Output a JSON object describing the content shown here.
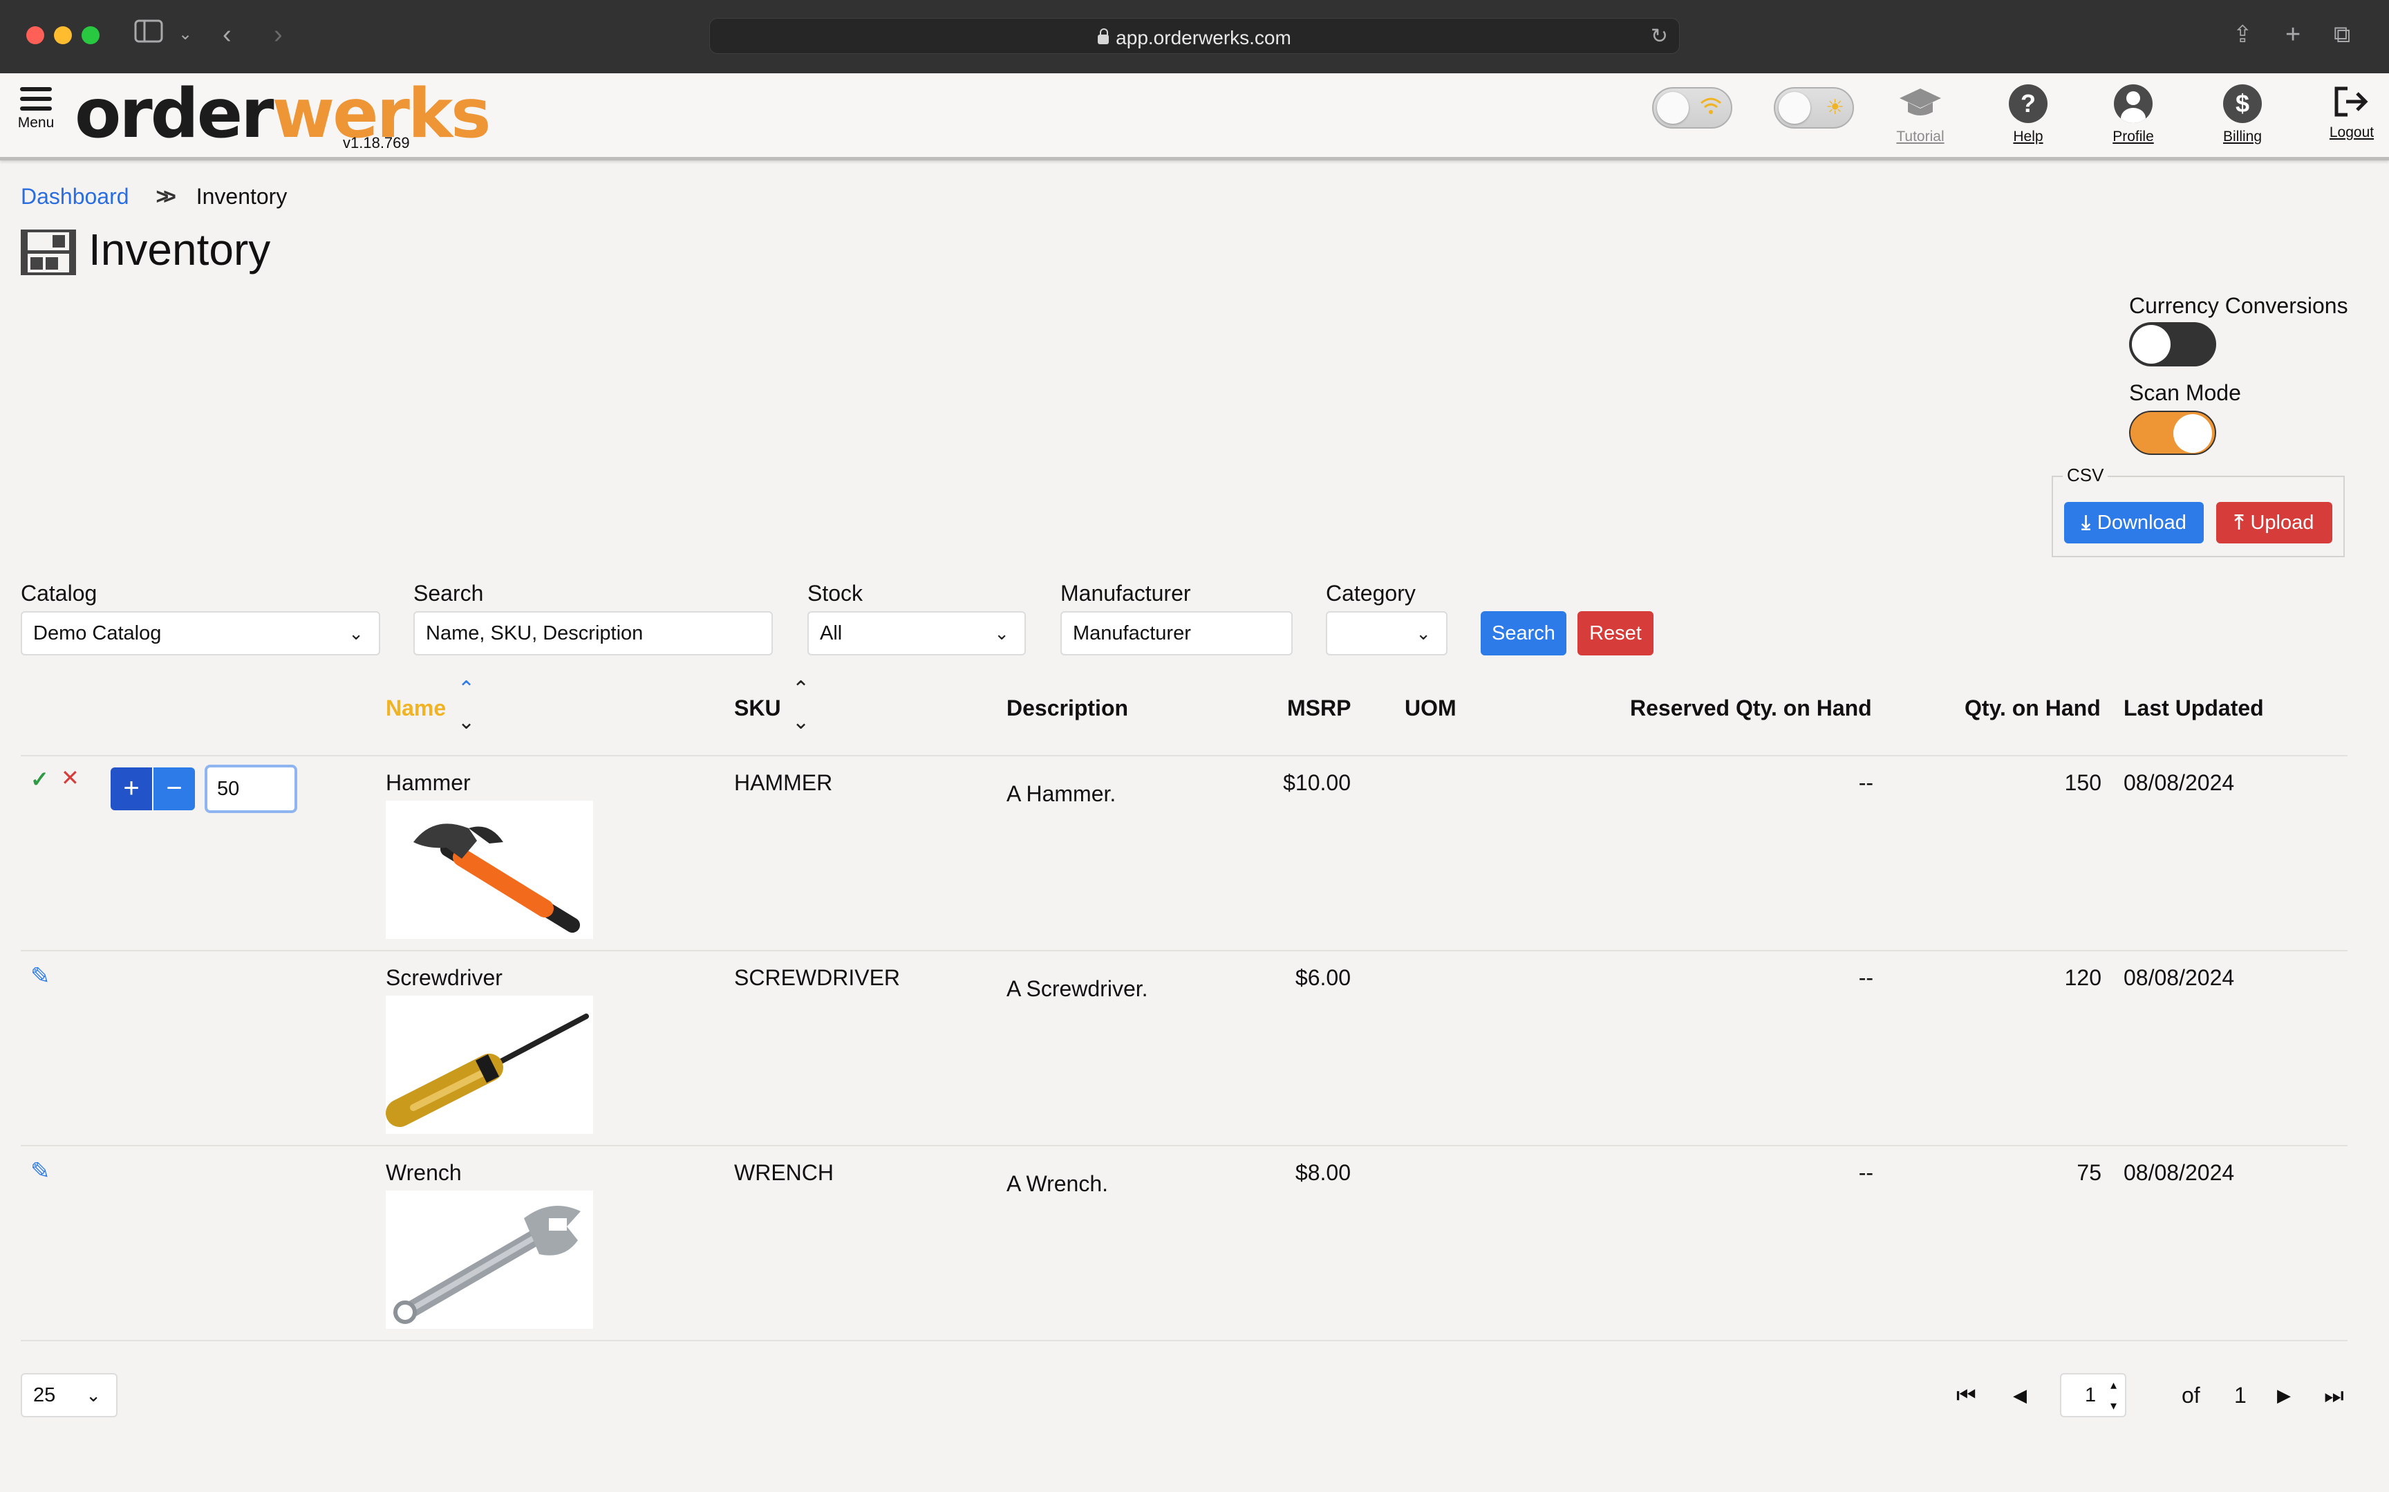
{
  "browser": {
    "url": "app.orderwerks.com"
  },
  "header": {
    "menu_label": "Menu",
    "logo_part1": "order",
    "logo_part2": "werks",
    "version": "v1.18.769",
    "nav": [
      {
        "label": "Tutorial",
        "icon": "graduation-cap-icon"
      },
      {
        "label": "Help",
        "icon": "question-icon"
      },
      {
        "label": "Profile",
        "icon": "user-icon"
      },
      {
        "label": "Billing",
        "icon": "dollar-icon"
      },
      {
        "label": "Logout",
        "icon": "logout-icon"
      }
    ],
    "toggles": [
      {
        "icon": "wifi-icon"
      },
      {
        "icon": "sun-icon"
      }
    ]
  },
  "breadcrumb": {
    "dashboard": "Dashboard",
    "current": "Inventory"
  },
  "page_title": "Inventory",
  "switches": {
    "currency_label": "Currency Conversions",
    "currency_on": false,
    "scan_label": "Scan Mode",
    "scan_on": true
  },
  "csv": {
    "legend": "CSV",
    "download": "Download",
    "upload": "Upload"
  },
  "filters": {
    "catalog_label": "Catalog",
    "catalog_value": "Demo Catalog",
    "search_label": "Search",
    "search_placeholder": "Name, SKU, Description",
    "stock_label": "Stock",
    "stock_value": "All",
    "manufacturer_label": "Manufacturer",
    "manufacturer_placeholder": "Manufacturer",
    "category_label": "Category",
    "category_value": "",
    "search_button": "Search",
    "reset_button": "Reset"
  },
  "table": {
    "headers": {
      "name": "Name",
      "sku": "SKU",
      "description": "Description",
      "msrp": "MSRP",
      "uom": "UOM",
      "reserved": "Reserved Qty. on Hand",
      "qty": "Qty. on Hand",
      "updated": "Last Updated"
    },
    "sorted_by": "Name",
    "scan_qty_value": "50",
    "rows": [
      {
        "name": "Hammer",
        "sku": "HAMMER",
        "description": "A Hammer.",
        "msrp": "$10.00",
        "uom": "",
        "reserved": "--",
        "qty": "150",
        "updated": "08/08/2024"
      },
      {
        "name": "Screwdriver",
        "sku": "SCREWDRIVER",
        "description": "A Screwdriver.",
        "msrp": "$6.00",
        "uom": "",
        "reserved": "--",
        "qty": "120",
        "updated": "08/08/2024"
      },
      {
        "name": "Wrench",
        "sku": "WRENCH",
        "description": "A Wrench.",
        "msrp": "$8.00",
        "uom": "",
        "reserved": "--",
        "qty": "75",
        "updated": "08/08/2024"
      }
    ]
  },
  "pagination": {
    "page_size": "25",
    "page": "1",
    "of_label": "of",
    "total_pages": "1"
  },
  "colors": {
    "brand_orange": "#ee9536",
    "primary_blue": "#2d7be8",
    "danger_red": "#d53c3a",
    "link_blue": "#2a6de0"
  }
}
